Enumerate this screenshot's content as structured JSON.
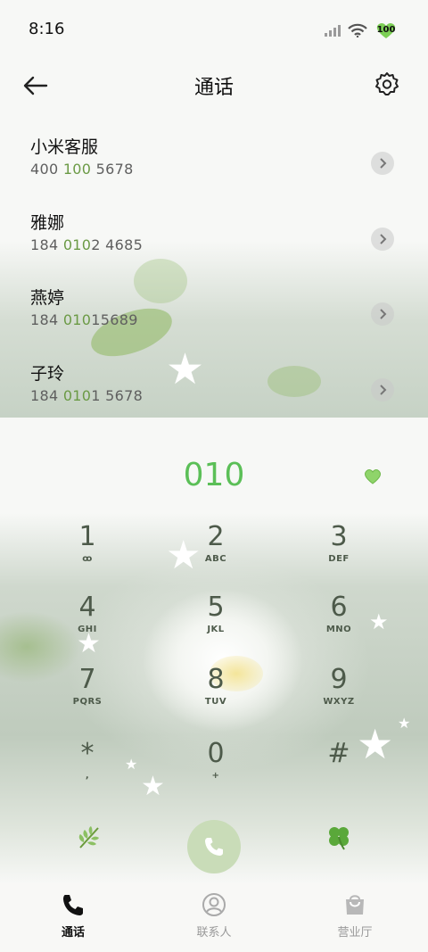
{
  "status_bar": {
    "time": "8:16",
    "battery": "100"
  },
  "header": {
    "title": "通话"
  },
  "contacts": [
    {
      "name": "小米客服",
      "num_pre": "400 ",
      "num_hl": "100",
      "num_post": " 5678"
    },
    {
      "name": "雅娜",
      "num_pre": "184 ",
      "num_hl": "010",
      "num_post": "2 4685"
    },
    {
      "name": "燕婷",
      "num_pre": "184 ",
      "num_hl": "010",
      "num_post": "15689"
    },
    {
      "name": "子玲",
      "num_pre": "184 ",
      "num_hl": "010",
      "num_post": "1 5678"
    }
  ],
  "dialer": {
    "entry": "010"
  },
  "keypad": [
    {
      "digit": "1",
      "letters": "ꝏ"
    },
    {
      "digit": "2",
      "letters": "ABC"
    },
    {
      "digit": "3",
      "letters": "DEF"
    },
    {
      "digit": "4",
      "letters": "GHI"
    },
    {
      "digit": "5",
      "letters": "JKL"
    },
    {
      "digit": "6",
      "letters": "MNO"
    },
    {
      "digit": "7",
      "letters": "PQRS"
    },
    {
      "digit": "8",
      "letters": "TUV"
    },
    {
      "digit": "9",
      "letters": "WXYZ"
    },
    {
      "digit": "*",
      "letters": ","
    },
    {
      "digit": "0",
      "letters": "+"
    },
    {
      "digit": "#",
      "letters": ""
    }
  ],
  "bottom_nav": [
    {
      "label": "通话",
      "active": true
    },
    {
      "label": "联系人",
      "active": false
    },
    {
      "label": "营业厅",
      "active": false
    }
  ],
  "colors": {
    "accent_green": "#5bbf57",
    "highlight_green": "#6b9a45",
    "key_text": "#4d5a4a",
    "call_button": "#c9dcb8"
  },
  "icons": {
    "back": "arrow-left-icon",
    "settings": "gear-icon",
    "chevron": "chevron-right-icon",
    "heart": "green-heart-icon",
    "call": "phone-icon",
    "left": "leaf-icon",
    "right": "clover-icon"
  }
}
